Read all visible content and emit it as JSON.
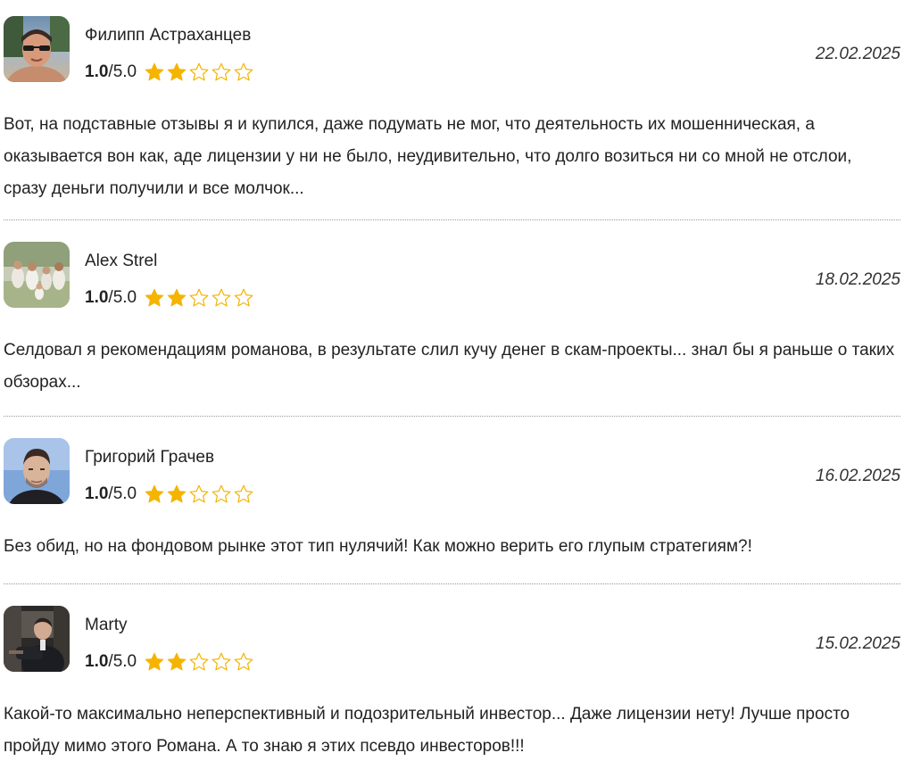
{
  "reviews": [
    {
      "name": "Филипп Астраханцев",
      "score_value": "1.0",
      "score_max": "/5.0",
      "stars_filled": 2,
      "stars_total": 5,
      "date": "22.02.2025",
      "avatar_icon": "person-sunglasses-beach-photo",
      "text": "Вот, на подставные отзывы я и купился, даже подумать не мог, что деятельность их мошенническая, а оказывается вон как, аде лицензии у ни не было, неудивительно, что долго возиться ни со мной не отслои, сразу деньги получили и все молчок..."
    },
    {
      "name": "Alex Strel",
      "score_value": "1.0",
      "score_max": "/5.0",
      "stars_filled": 2,
      "stars_total": 5,
      "date": "18.02.2025",
      "avatar_icon": "family-group-photo",
      "text": "Селдовал я рекомендациям романова, в результате слил кучу денег в скам-проекты... знал бы я раньше о таких обзорах..."
    },
    {
      "name": "Григорий Грачев",
      "score_value": "1.0",
      "score_max": "/5.0",
      "stars_filled": 2,
      "stars_total": 5,
      "date": "16.02.2025",
      "avatar_icon": "young-man-portrait-photo",
      "text": "Без обид, но на фондовом рынке этот тип нулячий! Как можно верить его глупым стратегиям?!"
    },
    {
      "name": "Marty",
      "score_value": "1.0",
      "score_max": "/5.0",
      "stars_filled": 2,
      "stars_total": 5,
      "date": "15.02.2025",
      "avatar_icon": "man-in-suit-sitting-photo",
      "text": "Какой-то максимально неперспективный и подозрительный инвестор... Даже лицензии нету! Лучше просто пройду мимо этого Романа. А то знаю я этих псевдо инвесторов!!!"
    }
  ],
  "colors": {
    "star_fill": "#f5b400",
    "star_outline": "#f5b400",
    "divider": "#9a9a9a"
  }
}
